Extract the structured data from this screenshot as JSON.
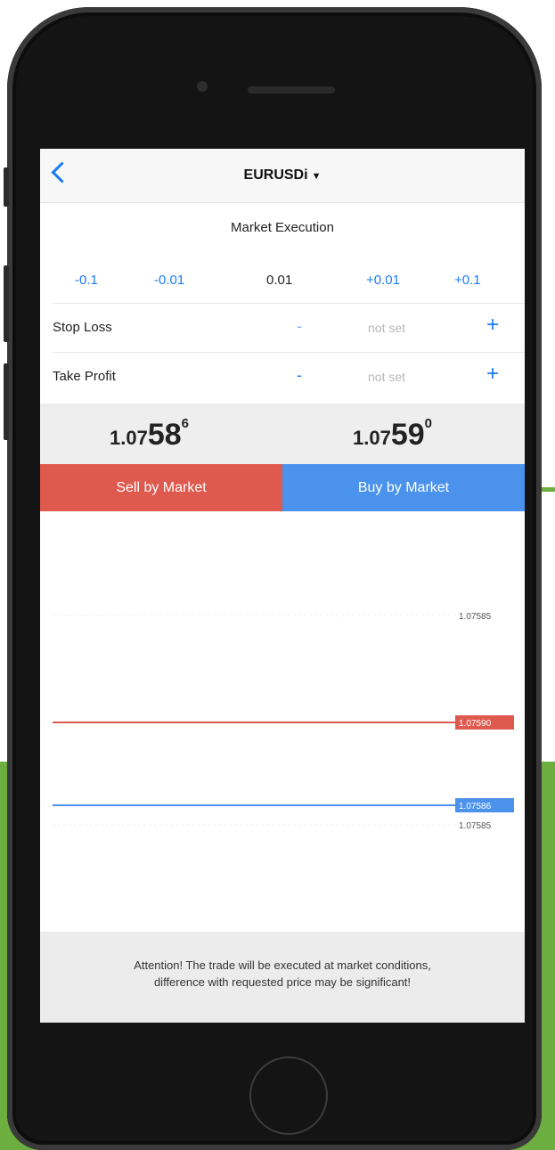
{
  "colors": {
    "accent": "#1a7cf5",
    "sell": "#de5a4e",
    "buy": "#4b92ec",
    "background_green": "#6cae3f"
  },
  "navbar": {
    "back_icon": "chevron-left-icon",
    "symbol": "EURUSDi",
    "dropdown_icon": "▼"
  },
  "execution": {
    "label": "Market Execution"
  },
  "volume": {
    "minus_large": "-0.1",
    "minus_small": "-0.01",
    "current": "0.01",
    "plus_small": "+0.01",
    "plus_large": "+0.1"
  },
  "stop_loss": {
    "label": "Stop Loss",
    "minus": "-",
    "value": "not set",
    "plus": "+"
  },
  "take_profit": {
    "label": "Take Profit",
    "minus": "-",
    "value": "not set",
    "plus": "+"
  },
  "prices": {
    "sell": {
      "prefix": "1.07",
      "big": "58",
      "sup": "6"
    },
    "buy": {
      "prefix": "1.07",
      "big": "59",
      "sup": "0"
    }
  },
  "buttons": {
    "sell": "Sell by Market",
    "buy": "Buy by Market"
  },
  "chart": {
    "top_level": "1.07585",
    "ask_tag": "1.07590",
    "bid_tag": "1.07586",
    "bottom_level": "1.07585"
  },
  "warning": {
    "line1": "Attention! The trade will be executed at market conditions,",
    "line2": "difference with requested price may be significant!"
  }
}
